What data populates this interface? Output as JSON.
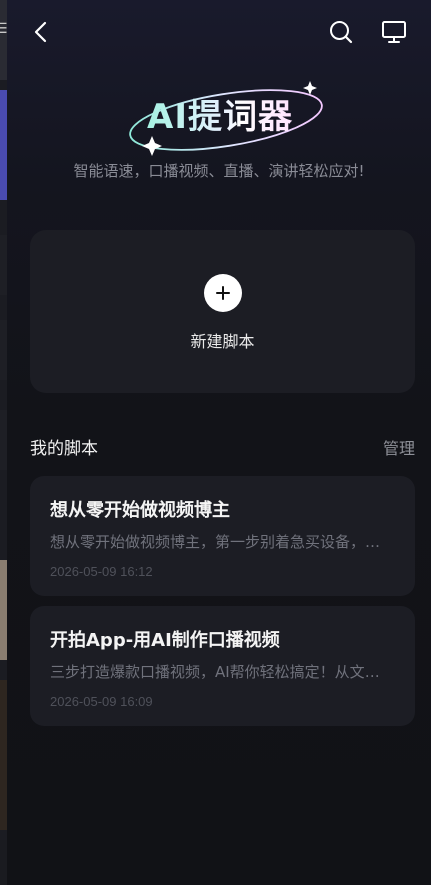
{
  "header": {
    "back_icon": "chevron-left-icon",
    "search_icon": "search-icon",
    "cast_icon": "monitor-icon"
  },
  "hero": {
    "title": "AI提词器",
    "tagline": "智能语速，口播视频、直播、演讲轻松应对!"
  },
  "new_script": {
    "label": "新建脚本",
    "icon": "plus-icon"
  },
  "my_scripts": {
    "title": "我的脚本",
    "manage_label": "管理",
    "items": [
      {
        "title": "想从零开始做视频博主",
        "preview": "想从零开始做视频博主，第一步别着急买设备，先找准定位再开拍",
        "date": "2026-05-09 16:12"
      },
      {
        "title": "开拍App-用AI制作口播视频",
        "preview": "三步打造爆款口播视频，AI帮你轻松搞定！从文案到成片一气呵成",
        "date": "2026-05-09 16:09"
      }
    ]
  },
  "colors": {
    "background": "#121318",
    "card": "#1c1d24",
    "accent_cyan": "#a6f2e3",
    "accent_pink": "#ffd6ff"
  }
}
